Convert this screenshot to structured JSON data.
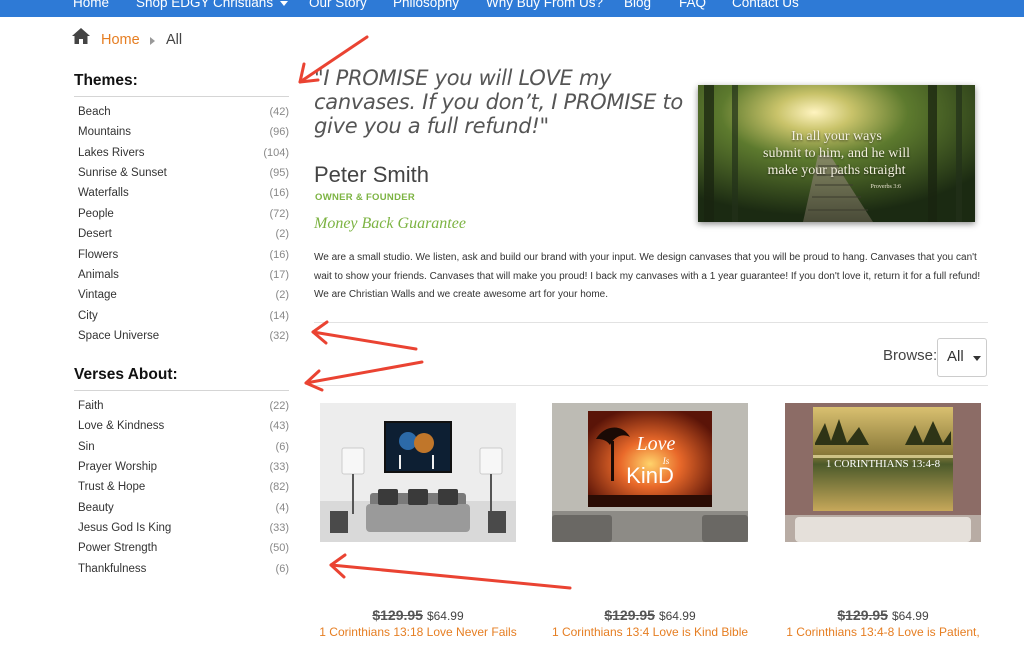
{
  "nav": {
    "items": [
      "Home",
      "Shop EDGY Christians",
      "Our Story",
      "Philosophy",
      "Why Buy From Us?",
      "Blog",
      "FAQ",
      "Contact Us"
    ]
  },
  "breadcrumb": {
    "home": "Home",
    "current": "All"
  },
  "sidebar": {
    "themes_title": "Themes:",
    "themes": [
      {
        "label": "Beach",
        "count": "(42)"
      },
      {
        "label": "Mountains",
        "count": "(96)"
      },
      {
        "label": "Lakes Rivers",
        "count": "(104)"
      },
      {
        "label": "Sunrise & Sunset",
        "count": "(95)"
      },
      {
        "label": "Waterfalls",
        "count": "(16)"
      },
      {
        "label": "People",
        "count": "(72)"
      },
      {
        "label": "Desert",
        "count": "(2)"
      },
      {
        "label": "Flowers",
        "count": "(16)"
      },
      {
        "label": "Animals",
        "count": "(17)"
      },
      {
        "label": "Vintage",
        "count": "(2)"
      },
      {
        "label": "City",
        "count": "(14)"
      },
      {
        "label": "Space Universe",
        "count": "(32)"
      }
    ],
    "verses_title": "Verses About:",
    "verses": [
      {
        "label": "Faith",
        "count": "(22)"
      },
      {
        "label": "Love & Kindness",
        "count": "(43)"
      },
      {
        "label": "Sin",
        "count": "(6)"
      },
      {
        "label": "Prayer Worship",
        "count": "(33)"
      },
      {
        "label": "Trust & Hope",
        "count": "(82)"
      },
      {
        "label": "Beauty",
        "count": "(4)"
      },
      {
        "label": "Jesus God Is King",
        "count": "(33)"
      },
      {
        "label": "Power Strength",
        "count": "(50)"
      },
      {
        "label": "Thankfulness",
        "count": "(6)"
      }
    ]
  },
  "intro": {
    "quote": "\"I PROMISE you will LOVE my canvases. If you don’t, I PROMISE to give you a full refund!\"",
    "author": "Peter Smith",
    "role": "OWNER & FOUNDER",
    "guarantee": "Money Back Guarantee",
    "hero_lines": [
      "In all your ways",
      "submit to him, and he will",
      "make your paths straight"
    ],
    "hero_ref": "Proverbs 3:6",
    "about": "We are a small studio. We listen, ask and build our brand with your input. We design canvases that you will be proud to hang. Canvases that you can't wait to show your friends. Canvases that will make you proud! I back my canvases with a 1 year guarantee! If you don't love it, return it for a full refund! We are Christian Walls and we create awesome art for your home."
  },
  "browse": {
    "label": "Browse:",
    "value": "All"
  },
  "products": [
    {
      "old_price": "$129.95",
      "price": "$64.99",
      "title": "1 Corinthians 13:18 Love Never Fails"
    },
    {
      "old_price": "$129.95",
      "price": "$64.99",
      "title": "1 Corinthians 13:4 Love is Kind Bible",
      "art_word1": "Love",
      "art_word2": "Is",
      "art_word3": "KinD"
    },
    {
      "old_price": "$129.95",
      "price": "$64.99",
      "title": "1 Corinthians 13:4-8 Love is Patient,",
      "art_text": "1 CORINTHIANS 13:4-8"
    }
  ],
  "colors": {
    "nav_bg": "#2e7ad6",
    "accent": "#e67e22",
    "green": "#7cb342",
    "annotation": "#ea4332"
  }
}
